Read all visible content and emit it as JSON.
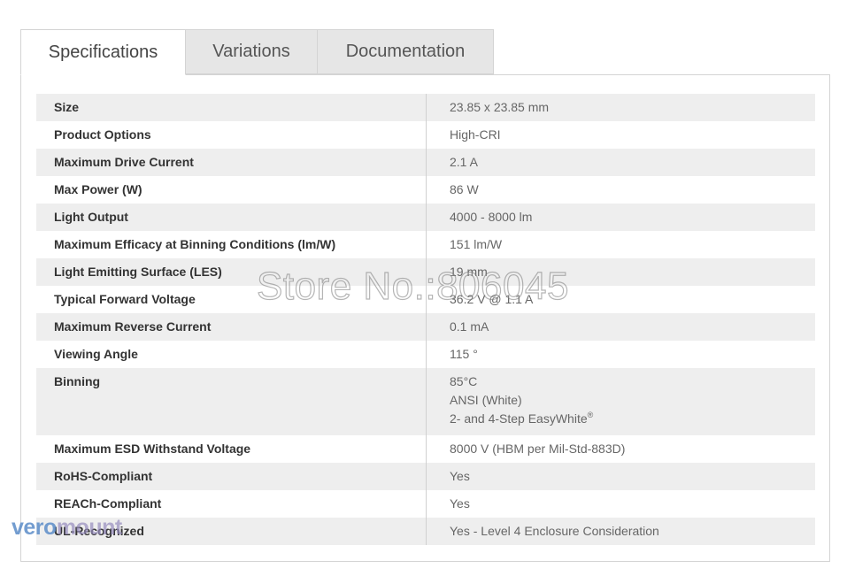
{
  "tabs": [
    {
      "label": "Specifications",
      "active": true
    },
    {
      "label": "Variations",
      "active": false
    },
    {
      "label": "Documentation",
      "active": false
    }
  ],
  "specs": [
    {
      "label": "Size",
      "value": "23.85 x 23.85 mm"
    },
    {
      "label": "Product Options",
      "value": "High-CRI"
    },
    {
      "label": "Maximum Drive Current",
      "value": "2.1 A"
    },
    {
      "label": "Max Power (W)",
      "value": "86 W"
    },
    {
      "label": "Light Output",
      "value": "4000 - 8000 lm"
    },
    {
      "label": "Maximum Efficacy at Binning Conditions (lm/W)",
      "value": "151 lm/W"
    },
    {
      "label": "Light Emitting Surface (LES)",
      "value": "19 mm"
    },
    {
      "label": "Typical Forward Voltage",
      "value": "36.2 V @ 1.1 A"
    },
    {
      "label": "Maximum Reverse Current",
      "value": "0.1 mA"
    },
    {
      "label": "Viewing Angle",
      "value": "115 °"
    },
    {
      "label": "Binning",
      "values": [
        "85°C",
        "ANSI (White)",
        "2- and 4-Step EasyWhite"
      ],
      "sup": "®"
    },
    {
      "label": "Maximum ESD Withstand Voltage",
      "value": "8000 V (HBM per Mil-Std-883D)"
    },
    {
      "label": "RoHS-Compliant",
      "value": "Yes"
    },
    {
      "label": "REACh-Compliant",
      "value": "Yes"
    },
    {
      "label": "UL-Recognized",
      "value": "Yes - Level 4 Enclosure Consideration"
    }
  ],
  "watermark": "Store No.:806045",
  "logo": {
    "part1": "vero",
    "part2": "mount"
  }
}
